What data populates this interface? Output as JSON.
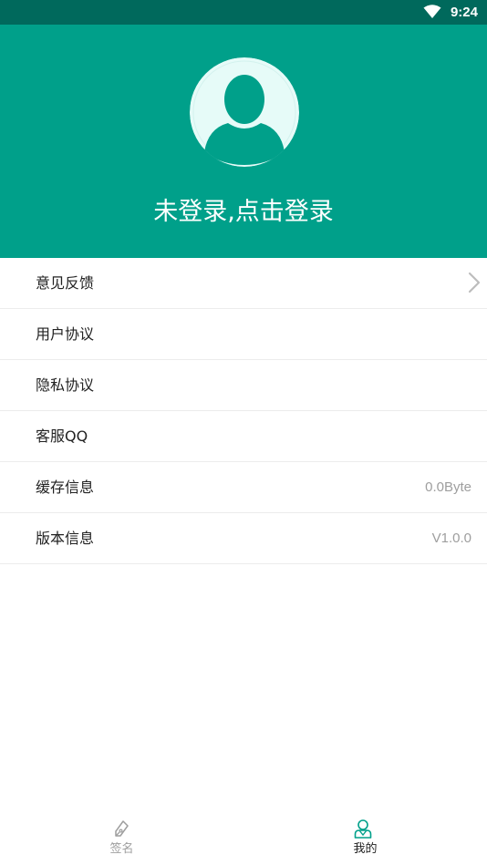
{
  "status_bar": {
    "time": "9:24",
    "wifi_icon": "wifi-icon"
  },
  "header": {
    "background_color": "#00a08a",
    "avatar_icon": "default-avatar-icon",
    "login_text": "未登录,点击登录"
  },
  "menu": {
    "items": [
      {
        "label": "意见反馈",
        "value": "",
        "icon": "chevron-right-icon"
      },
      {
        "label": "用户协议",
        "value": ""
      },
      {
        "label": "隐私协议",
        "value": ""
      },
      {
        "label": "客服QQ",
        "value": ""
      },
      {
        "label": "缓存信息",
        "value": "0.0Byte"
      },
      {
        "label": "版本信息",
        "value": "V1.0.0"
      }
    ]
  },
  "tab_bar": {
    "active_color": "#00a08a",
    "inactive_color": "#9e9e9e",
    "tabs": [
      {
        "label": "签名",
        "icon": "pen-icon",
        "active": false
      },
      {
        "label": "我的",
        "icon": "user-icon",
        "active": true
      }
    ]
  }
}
